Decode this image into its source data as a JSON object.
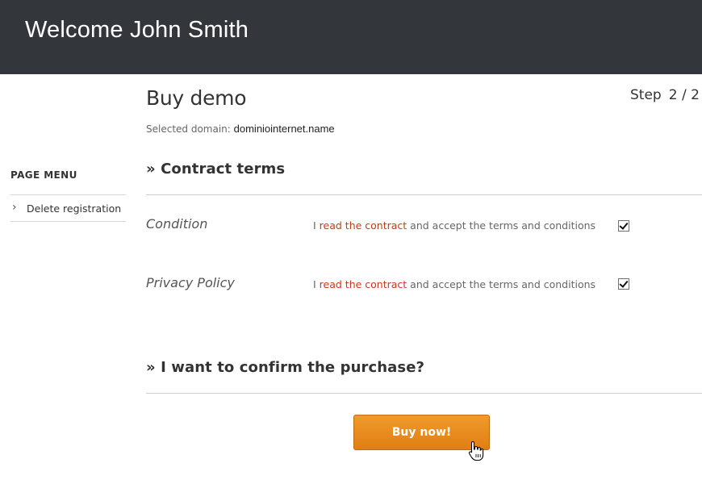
{
  "header": {
    "title": "Welcome John Smith"
  },
  "page": {
    "title": "Buy demo",
    "step_label": "Step",
    "step_value": "2 / 2"
  },
  "domain": {
    "label": "Selected domain: ",
    "value": "dominiointernet.name"
  },
  "side_menu": {
    "title": "PAGE MENU",
    "items": [
      {
        "label": "Delete registration",
        "icon": "chevron-right-icon"
      }
    ]
  },
  "sections": {
    "contract": "» Contract terms",
    "confirm": "» I want to confirm the purchase?"
  },
  "rows": [
    {
      "label": "Condition",
      "prefix": "I ",
      "link": "read the contract",
      "suffix": " and accept the terms and conditions",
      "checked": true
    },
    {
      "label": "Privacy Policy",
      "prefix": "I ",
      "link": "read the contract",
      "suffix": " and accept the terms and conditions",
      "checked": true
    }
  ],
  "buttons": {
    "buy": "Buy now!"
  },
  "colors": {
    "header_bg": "#33373b",
    "link": "#c8391a",
    "button": "#e88a1f"
  }
}
